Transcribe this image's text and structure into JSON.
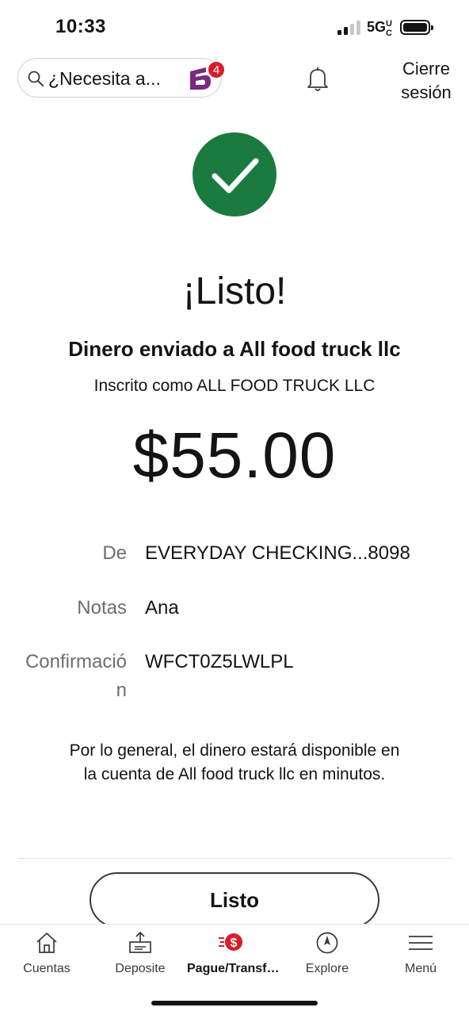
{
  "status_bar": {
    "time": "10:33",
    "network": "5G",
    "network_suffix": "UC"
  },
  "header": {
    "search_placeholder": "¿Necesita a...",
    "notification_count": "4",
    "logout_label": "Cierre sesión",
    "icons": [
      "search-icon",
      "assistant-icon",
      "bell-icon"
    ]
  },
  "confirmation": {
    "title": "¡Listo!",
    "sent_to": "Dinero enviado a All food truck llc",
    "registered_as": "Inscrito como ALL FOOD TRUCK LLC",
    "amount": "$55.00",
    "details": [
      {
        "label": "De",
        "value": "EVERYDAY CHECKING...8098"
      },
      {
        "label": "Notas",
        "value": "Ana"
      },
      {
        "label": "Confirmación",
        "value": "WFCT0Z5LWLPL"
      }
    ],
    "note": "Por lo general, el dinero estará disponible en la cuenta de All food truck llc en minutos.",
    "done_button": "Listo",
    "success_color": "#1b7a3e"
  },
  "bottom_nav": {
    "items": [
      {
        "label": "Cuentas",
        "icon": "home-icon"
      },
      {
        "label": "Deposite",
        "icon": "deposit-icon"
      },
      {
        "label": "Pague/Transfiera",
        "icon": "pay-transfer-icon",
        "active": true
      },
      {
        "label": "Explore",
        "icon": "compass-icon"
      },
      {
        "label": "Menú",
        "icon": "menu-icon"
      }
    ],
    "accent_color": "#d71e28"
  }
}
